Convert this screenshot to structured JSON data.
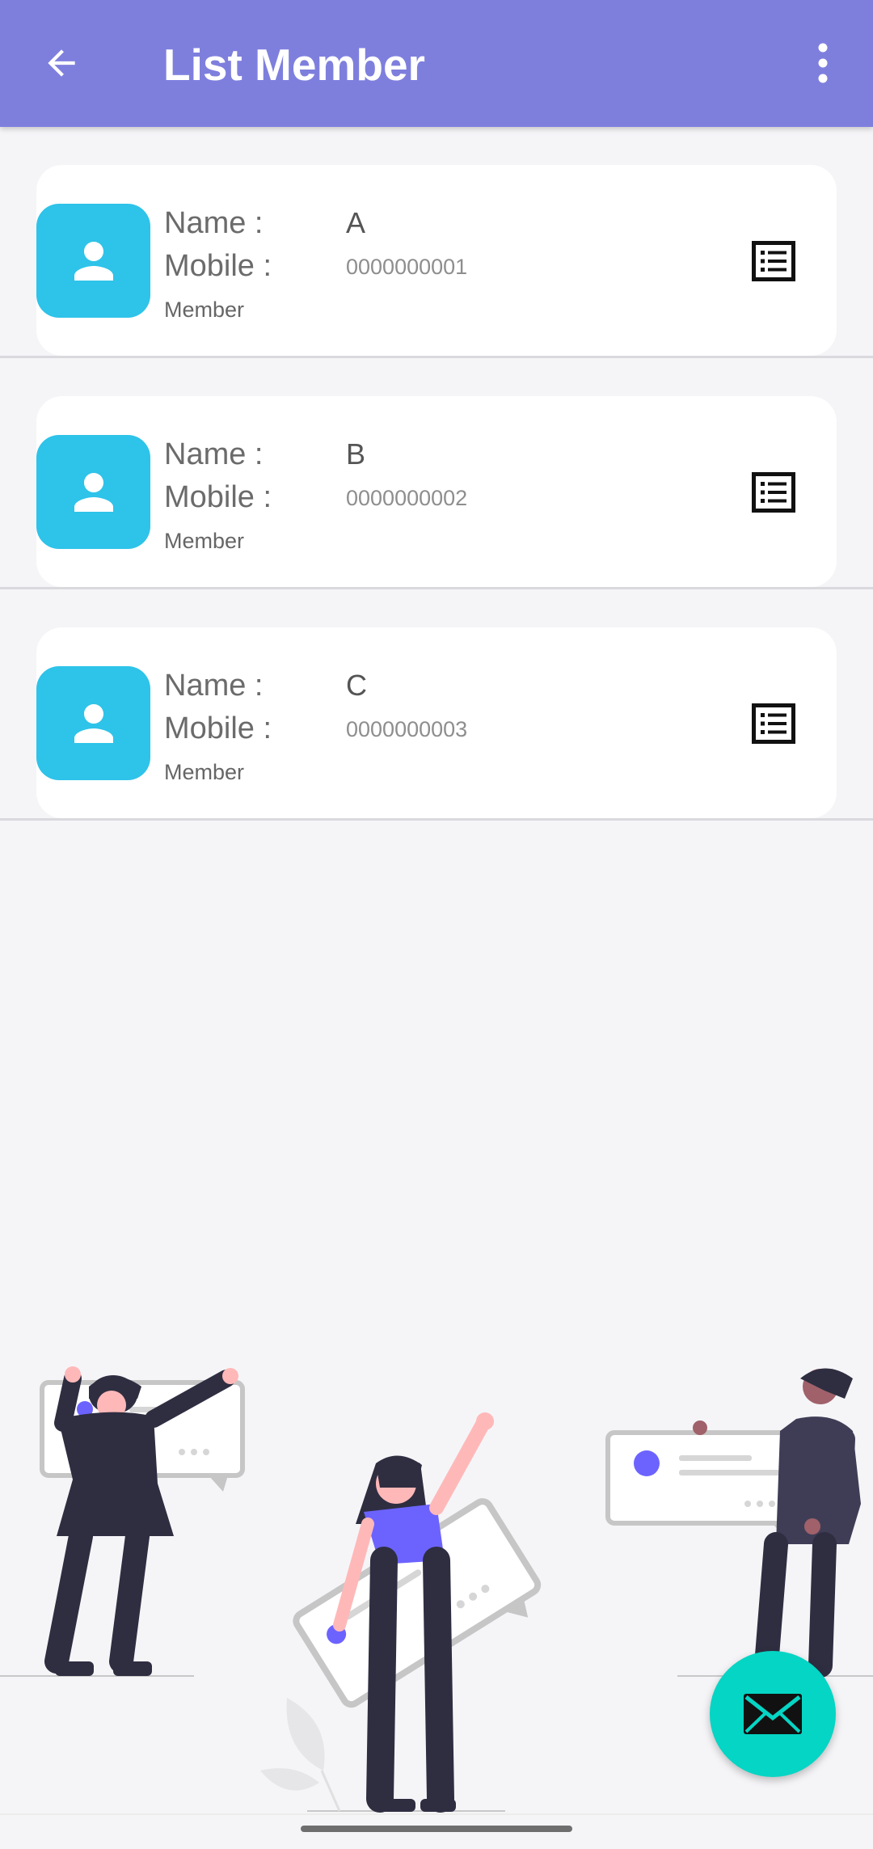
{
  "appbar": {
    "title": "List Member",
    "back_icon": "arrow-left-icon",
    "more_icon": "more-vert-icon",
    "color": "#7e7fdd"
  },
  "members": [
    {
      "name_label": "Name :",
      "mobile_label": "Mobile :",
      "name": "A",
      "mobile": "0000000001",
      "role": "Member"
    },
    {
      "name_label": "Name :",
      "mobile_label": "Mobile :",
      "name": "B",
      "mobile": "0000000002",
      "role": "Member"
    },
    {
      "name_label": "Name :",
      "mobile_label": "Mobile :",
      "name": "C",
      "mobile": "0000000003",
      "role": "Member"
    }
  ],
  "icons": {
    "avatar": "person-icon",
    "details": "list-details-icon",
    "fab": "mail-icon"
  },
  "colors": {
    "avatar_bg": "#2ec3e9",
    "fab_bg": "#05d5c4",
    "accent_purple": "#6c63ff"
  }
}
